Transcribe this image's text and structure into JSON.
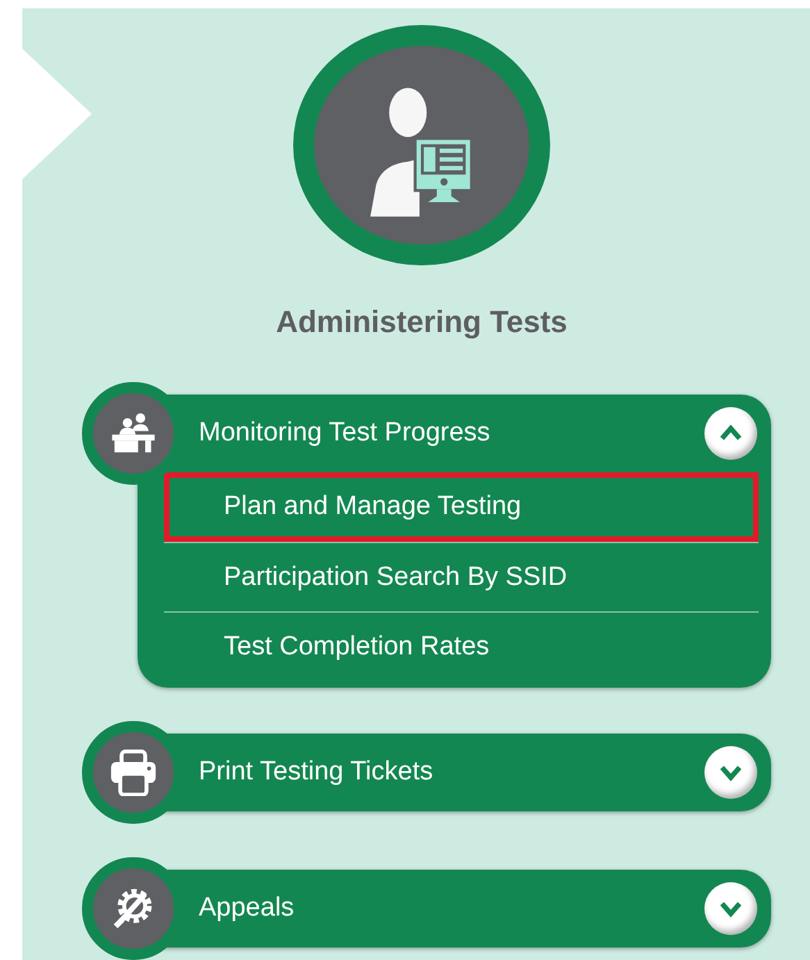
{
  "title": "Administering Tests",
  "sections": [
    {
      "kind": "desk",
      "label": "Monitoring Test Progress",
      "expanded": true,
      "items": [
        {
          "label": "Plan and Manage Testing",
          "highlighted": true
        },
        {
          "label": "Participation Search By SSID",
          "highlighted": false
        },
        {
          "label": "Test Completion Rates",
          "highlighted": false
        }
      ]
    },
    {
      "kind": "printer",
      "label": "Print Testing Tickets",
      "expanded": false
    },
    {
      "kind": "tools",
      "label": "Appeals",
      "expanded": false
    }
  ]
}
